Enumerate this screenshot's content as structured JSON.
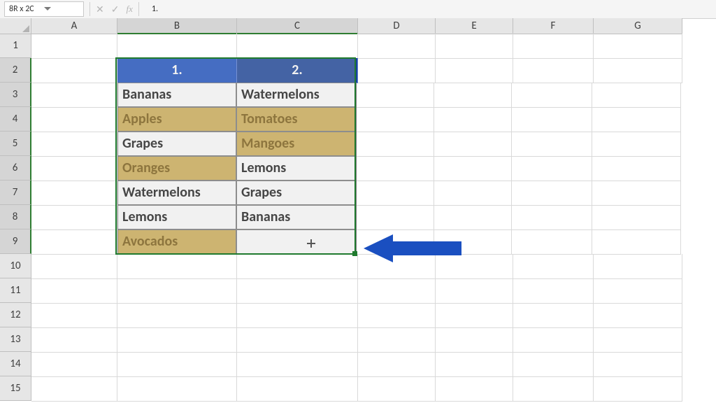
{
  "formulaBar": {
    "nameBox": "8R x 2C",
    "fxLabel": "fx",
    "formula": "1."
  },
  "columns": [
    "A",
    "B",
    "C",
    "D",
    "E",
    "F",
    "G"
  ],
  "rowCount": 15,
  "selectedCols": [
    "B",
    "C"
  ],
  "selectedRows": [
    2,
    3,
    4,
    5,
    6,
    7,
    8,
    9
  ],
  "table": {
    "headers": {
      "col1": "1.",
      "col2": "2."
    },
    "rows": [
      {
        "b": "Bananas",
        "bHL": false,
        "c": "Watermelons",
        "cHL": false
      },
      {
        "b": "Apples",
        "bHL": true,
        "c": "Tomatoes",
        "cHL": true
      },
      {
        "b": "Grapes",
        "bHL": false,
        "c": "Mangoes",
        "cHL": true
      },
      {
        "b": "Oranges",
        "bHL": true,
        "c": "Lemons",
        "cHL": false
      },
      {
        "b": "Watermelons",
        "bHL": false,
        "c": "Grapes",
        "cHL": false
      },
      {
        "b": "Lemons",
        "bHL": false,
        "c": "Bananas",
        "cHL": false
      },
      {
        "b": "Avocados",
        "bHL": true,
        "c": "",
        "cHL": false
      }
    ]
  },
  "colors": {
    "headerBlue1": "#1a4fc0",
    "headerBlue2": "#184299",
    "highlightFill": "#cfae54",
    "highlightText": "#7a5a10",
    "selectionBorder": "#1f7a2e",
    "arrow": "#1a4fc0"
  }
}
